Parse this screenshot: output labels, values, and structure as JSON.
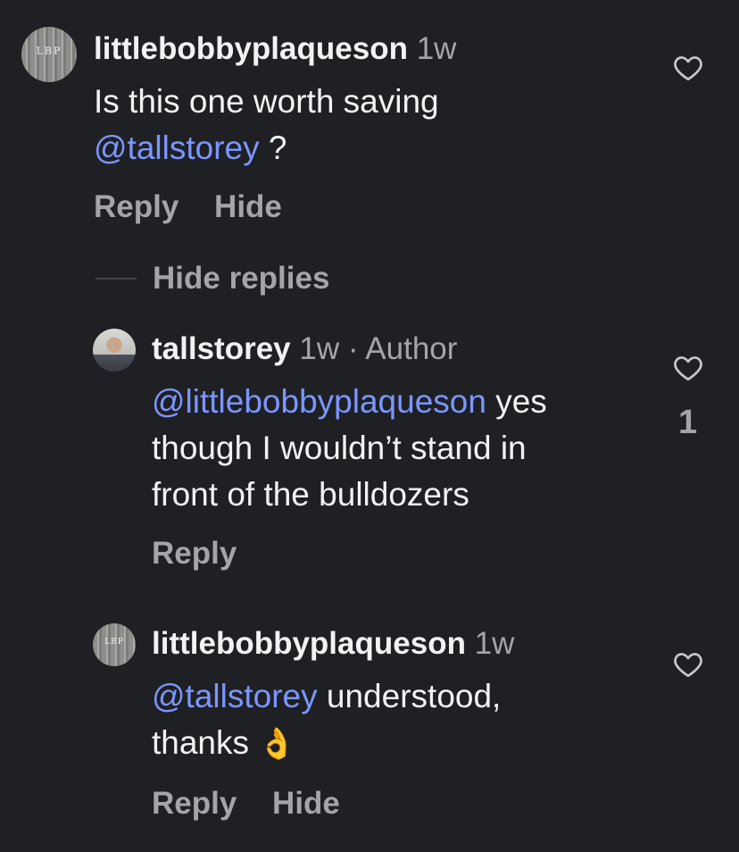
{
  "comments": [
    {
      "username": "littlebobbyplaqueson",
      "age": "1w",
      "avatar_text": "LBP",
      "text_lines": [
        [
          "Is this one worth saving"
        ]
      ],
      "mention": "@tallstorey",
      "tail": " ?",
      "reply_label": "Reply",
      "hide_label": "Hide"
    }
  ],
  "thread": {
    "hide_replies_label": "Hide replies"
  },
  "replies": [
    {
      "username": "tallstorey",
      "age": "1w",
      "author_tag": "· Author",
      "mention": "@littlebobbyplaqueson",
      "line1_tail": " yes",
      "line2": "though I wouldn’t stand in",
      "line3": "front of the bulldozers",
      "reply_label": "Reply",
      "like_count": "1"
    },
    {
      "username": "littlebobbyplaqueson",
      "age": "1w",
      "avatar_text": "LBP",
      "mention": "@tallstorey",
      "line1_tail": " understood,",
      "line2": "thanks",
      "emoji": "👌",
      "reply_label": "Reply",
      "hide_label": "Hide"
    }
  ],
  "icons": {
    "like": "heart-outline-icon",
    "emoji": "ok-hand-icon"
  },
  "colors": {
    "background": "#1f2024",
    "text": "#f2f2f4",
    "secondary": "#a4a4aa",
    "mention": "#7b96ff"
  }
}
